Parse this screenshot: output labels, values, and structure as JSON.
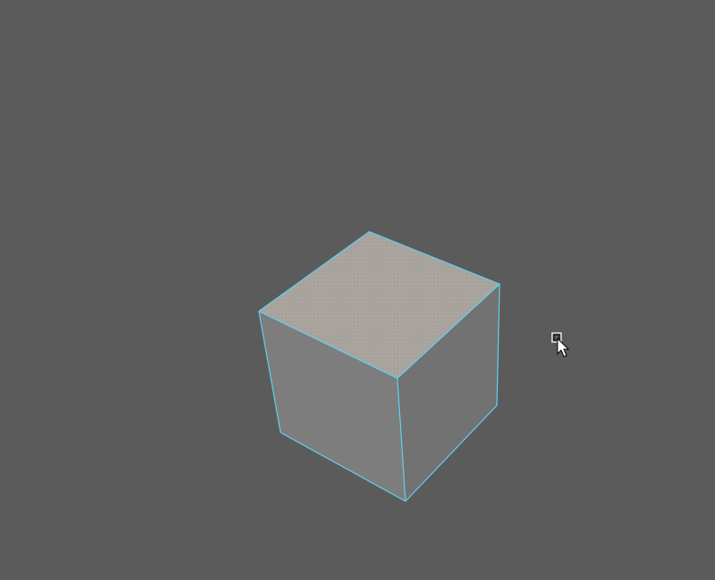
{
  "viewport": {
    "background_color": "#5b5b5b"
  },
  "object": {
    "type": "cube",
    "selected": true,
    "colors": {
      "top_face": "#a8a29c",
      "top_face_dot": "#b8b2ac",
      "left_face": "#7d7d7d",
      "right_face": "#727272",
      "selection_edge": "#5fd0f0"
    }
  },
  "cursor": {
    "icon": "arrow-with-box-cursor-icon",
    "color": "#ffffff",
    "outline_color": "#000000"
  }
}
